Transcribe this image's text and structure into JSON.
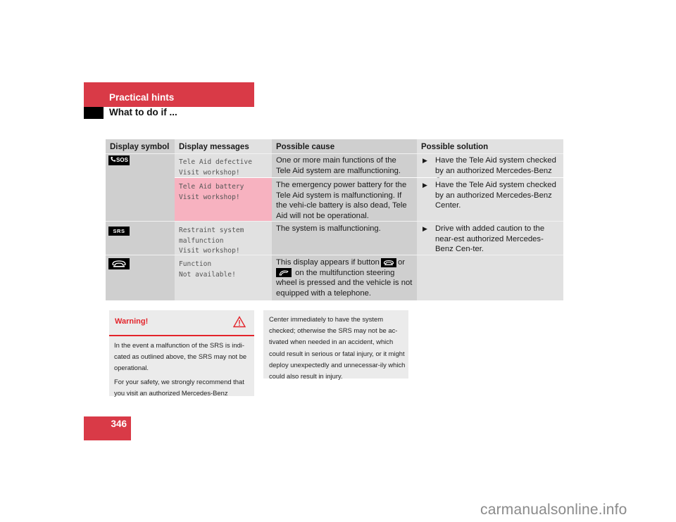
{
  "header": {
    "section": "Practical hints",
    "subsection": "What to do if ..."
  },
  "table": {
    "columns": [
      "Display symbol",
      "Display messages",
      "Possible cause",
      "Possible solution"
    ],
    "rows": [
      {
        "symbol": "tele-aid-sos",
        "symbol_label": "SOS",
        "message_lines": [
          "Tele Aid defective",
          "Visit workshop!"
        ],
        "cause": "One or more main functions of the Tele Aid system are malfunctioning.",
        "solution": "Have the Tele Aid system checked by an authorized Mercedes-Benz Center.",
        "highlight": false
      },
      {
        "symbol": "",
        "message_lines": [
          "Tele Aid battery",
          "Visit workshop!"
        ],
        "cause": "The emergency power battery for the Tele Aid system is malfunctioning. If the vehi-cle battery is also dead, Tele Aid will not be operational.",
        "solution": "Have the Tele Aid system checked by an authorized Mercedes-Benz Center.",
        "highlight": true
      },
      {
        "symbol": "srs",
        "symbol_label": "SRS",
        "message_lines": [
          "Restraint system",
          "malfunction",
          "Visit workshop!"
        ],
        "cause": "The system is malfunctioning.",
        "solution": "Drive with added caution to the near-est authorized Mercedes-Benz Cen-ter.",
        "highlight": false
      },
      {
        "symbol": "phone-end",
        "message_lines": [
          "Function",
          "Not available!"
        ],
        "cause_parts": [
          "This display appears if button",
          "or",
          "on the multifunction steering wheel is pressed and the vehicle is not equipped with a telephone."
        ],
        "solution": "",
        "highlight": false
      }
    ]
  },
  "warning": {
    "title": "Warning!",
    "paragraphs": [
      "In the event a malfunction of the SRS is indi-cated as outlined above, the SRS may not be operational.",
      "For your safety, we strongly recommend that you visit an authorized Mercedes-Benz"
    ],
    "continuation": "Center immediately to have the system checked; otherwise the SRS may not be ac-tivated when needed in an accident, which could result in serious or fatal injury, or it might deploy unexpectedly and unnecessar-ily which could also result in injury."
  },
  "footer": {
    "page_number": "346",
    "watermark": "carmanualsonline.info"
  },
  "colors": {
    "brand_red": "#d93a47",
    "warning_red": "#e3242b",
    "highlight_pink": "#f7b2c0"
  }
}
